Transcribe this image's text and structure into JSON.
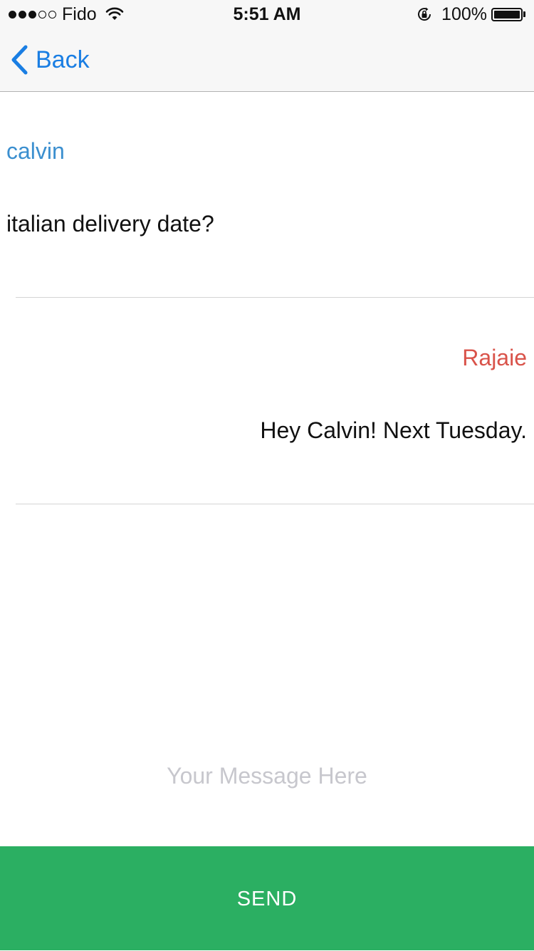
{
  "status_bar": {
    "carrier": "Fido",
    "signal_bars_filled": 3,
    "signal_bars_total": 5,
    "time": "5:51 AM",
    "battery_percent": "100%",
    "battery_level": 1.0,
    "icons": [
      "wifi-icon",
      "orientation-lock-icon",
      "battery-icon"
    ]
  },
  "nav": {
    "back_label": "Back",
    "accent_color": "#1a7ee3"
  },
  "messages": [
    {
      "sender": "calvin",
      "text": "italian delivery date?",
      "sender_color": "#3b8fcf",
      "align": "left"
    },
    {
      "sender": "Rajaie",
      "text": "Hey Calvin! Next Tuesday.",
      "sender_color": "#d9534a",
      "align": "right"
    }
  ],
  "composer": {
    "value": "",
    "placeholder": "Your Message Here"
  },
  "send_button": {
    "label": "SEND",
    "color": "#2baf62"
  }
}
